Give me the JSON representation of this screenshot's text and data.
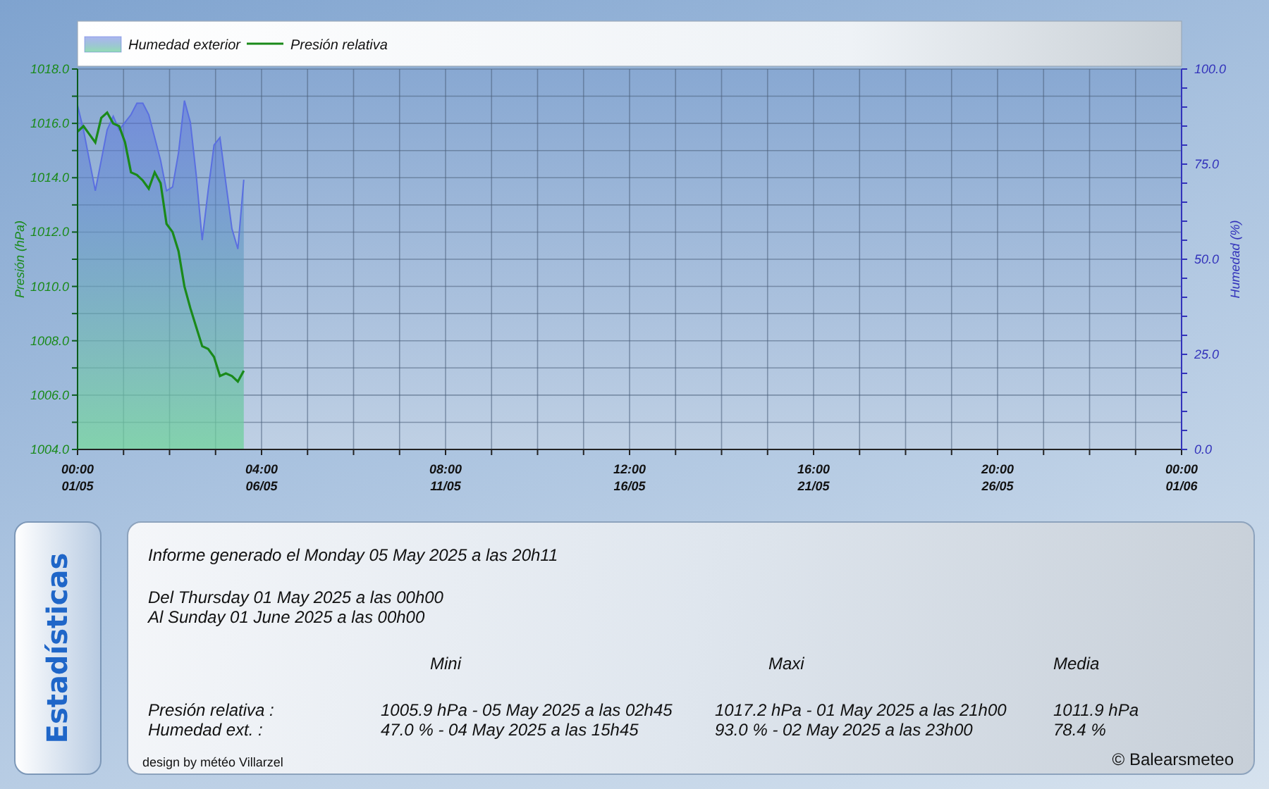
{
  "chart": {
    "chart_data": {
      "type": "line",
      "ylabel": "Presión (hPa)",
      "y2label": "Humedad (%)",
      "grid": true,
      "legend": true,
      "categories": [
        "00:00 01/05",
        null,
        null,
        null,
        null,
        null,
        null,
        null,
        null,
        null,
        null,
        null,
        null,
        null,
        null,
        null,
        null,
        null,
        null,
        null,
        null,
        null,
        null,
        null,
        null,
        null,
        null,
        null,
        null,
        null,
        null,
        "04:00 06/05",
        null,
        null,
        null,
        null,
        null,
        null,
        null,
        null,
        null,
        null,
        null,
        null,
        null,
        null,
        null,
        null,
        null,
        null,
        null,
        null,
        null,
        null,
        null,
        null,
        null,
        null,
        null,
        null,
        null,
        null,
        "08:00 11/05",
        null,
        null,
        null,
        null,
        null,
        null,
        null,
        null,
        null,
        null,
        null,
        null,
        null,
        null,
        null,
        null,
        null,
        null,
        null,
        null,
        null,
        null,
        null,
        null,
        null,
        null,
        null,
        null,
        null,
        null,
        "12:00 16/05",
        null,
        null,
        null,
        null,
        null,
        null,
        null,
        null,
        null,
        null,
        null,
        null,
        null,
        null,
        null,
        null,
        null,
        null,
        null,
        null,
        null,
        null,
        null,
        null,
        null,
        null,
        null,
        null,
        null,
        null,
        "16:00 21/05",
        null,
        null,
        null,
        null,
        null,
        null,
        null,
        null,
        null,
        null,
        null,
        null,
        null,
        null,
        null,
        null,
        null,
        null,
        null,
        null,
        null,
        null,
        null,
        null,
        null,
        null,
        null,
        null,
        null,
        null,
        "20:00 26/05",
        null,
        null,
        null,
        null,
        null,
        null,
        null,
        null,
        null,
        null,
        null,
        null,
        null,
        null,
        null,
        null,
        null,
        null,
        null,
        null,
        null,
        null,
        null,
        null,
        null,
        null,
        null,
        null,
        null,
        null,
        "00:00 01/06"
      ],
      "ylim": [
        1004,
        1018
      ],
      "yticks": [
        {
          "value": 1004,
          "label": "1004.0"
        },
        {
          "value": 1006,
          "label": "1006.0"
        },
        {
          "value": 1008,
          "label": "1008.0"
        },
        {
          "value": 1010,
          "label": "1010.0"
        },
        {
          "value": 1012,
          "label": "1012.0"
        },
        {
          "value": 1014,
          "label": "1014.0"
        },
        {
          "value": 1016,
          "label": "1016.0"
        },
        {
          "value": 1018,
          "label": "1018.0"
        }
      ],
      "y2lim": [
        0,
        100
      ],
      "y2ticks": [
        {
          "value": 0,
          "label": "0.0"
        },
        {
          "value": 25,
          "label": "25.0"
        },
        {
          "value": 50,
          "label": "50.0"
        },
        {
          "value": 75,
          "label": "75.0"
        },
        {
          "value": 100,
          "label": "100.0"
        }
      ],
      "series": [
        {
          "name": "Humedad exterior",
          "color": "#5a6fe0",
          "axis": "y2",
          "values": [
            90.5,
            84,
            76,
            68,
            76,
            84,
            87.6,
            84,
            86,
            88,
            91,
            91,
            88,
            82,
            76,
            68,
            69,
            78,
            91.7,
            86,
            72,
            55,
            68,
            80,
            82,
            70,
            58,
            52.7,
            70.9,
            null,
            null,
            null,
            null,
            null,
            null,
            null,
            null,
            null,
            null,
            null,
            null,
            null,
            null,
            null,
            null,
            null,
            null,
            null,
            null,
            null,
            null,
            null,
            null,
            null,
            null,
            null,
            null,
            null,
            null,
            null,
            null,
            null,
            null,
            null,
            null,
            null,
            null,
            null,
            null,
            null,
            null,
            null,
            null,
            null,
            null,
            null,
            null,
            null,
            null,
            null,
            null,
            null,
            null,
            null,
            null,
            null,
            null,
            null,
            null,
            null,
            null,
            null,
            null,
            null,
            null,
            null,
            null,
            null,
            null,
            null,
            null,
            null,
            null,
            null,
            null,
            null,
            null,
            null,
            null,
            null,
            null,
            null,
            null,
            null,
            null,
            null,
            null,
            null,
            null,
            null,
            null,
            null,
            null,
            null,
            null,
            null,
            null,
            null,
            null,
            null,
            null,
            null,
            null,
            null,
            null,
            null,
            null,
            null,
            null,
            null,
            null,
            null,
            null,
            null,
            null,
            null,
            null,
            null,
            null,
            null,
            null,
            null,
            null,
            null,
            null,
            null,
            null,
            null,
            null,
            null,
            null,
            null,
            null,
            null,
            null,
            null,
            null,
            null,
            null,
            null,
            null,
            null,
            null,
            null,
            null,
            null,
            null,
            null,
            null,
            null,
            null,
            null,
            null,
            null,
            null,
            null,
            null
          ]
        },
        {
          "name": "Presión relativa",
          "color": "#1a8a1a",
          "values": [
            1015.7,
            1015.9,
            1015.6,
            1015.3,
            1016.2,
            1016.4,
            1016.0,
            1015.9,
            1015.3,
            1014.2,
            1014.1,
            1013.9,
            1013.6,
            1014.2,
            1013.8,
            1012.3,
            1012.0,
            1011.3,
            1010.0,
            1009.2,
            1008.5,
            1007.8,
            1007.7,
            1007.4,
            1006.7,
            1006.8,
            1006.7,
            1006.5,
            1006.9,
            null,
            null,
            null,
            null,
            null,
            null,
            null,
            null,
            null,
            null,
            null,
            null,
            null,
            null,
            null,
            null,
            null,
            null,
            null,
            null,
            null,
            null,
            null,
            null,
            null,
            null,
            null,
            null,
            null,
            null,
            null,
            null,
            null,
            null,
            null,
            null,
            null,
            null,
            null,
            null,
            null,
            null,
            null,
            null,
            null,
            null,
            null,
            null,
            null,
            null,
            null,
            null,
            null,
            null,
            null,
            null,
            null,
            null,
            null,
            null,
            null,
            null,
            null,
            null,
            null,
            null,
            null,
            null,
            null,
            null,
            null,
            null,
            null,
            null,
            null,
            null,
            null,
            null,
            null,
            null,
            null,
            null,
            null,
            null,
            null,
            null,
            null,
            null,
            null,
            null,
            null,
            null,
            null,
            null,
            null,
            null,
            null,
            null,
            null,
            null,
            null,
            null,
            null,
            null,
            null,
            null,
            null,
            null,
            null,
            null,
            null,
            null,
            null,
            null,
            null,
            null,
            null,
            null,
            null,
            null,
            null,
            null,
            null,
            null,
            null,
            null,
            null,
            null,
            null,
            null,
            null,
            null,
            null,
            null,
            null,
            null,
            null,
            null,
            null,
            null,
            null,
            null,
            null,
            null,
            null,
            null,
            null,
            null,
            null,
            null,
            null,
            null,
            null,
            null,
            null,
            null,
            null,
            null
          ]
        }
      ]
    }
  },
  "stats": {
    "tab": "Estadísticas",
    "generated": "Informe generado el Monday 05 May 2025 a las 20h11",
    "period": [
      "Del Thursday 01 May 2025 a las 00h00",
      "Al Sunday 01 June 2025 a las 00h00"
    ],
    "columns": [
      "Mini",
      "Maxi",
      "Media"
    ],
    "rows": [
      {
        "label": "Presión relativa :",
        "mini": "1005.9 hPa - 05 May 2025 a las 02h45",
        "maxi": "1017.2 hPa - 01 May 2025 a las 21h00",
        "media": "1011.9 hPa"
      },
      {
        "label": "Humedad ext. :",
        "mini": "47.0 % - 04 May 2025 a las 15h45",
        "maxi": "93.0 % - 02 May 2025 a las 23h00",
        "media": "78.4 %"
      }
    ],
    "design": "design by météo Villarzel",
    "copyright": "© Balearsmeteo"
  }
}
